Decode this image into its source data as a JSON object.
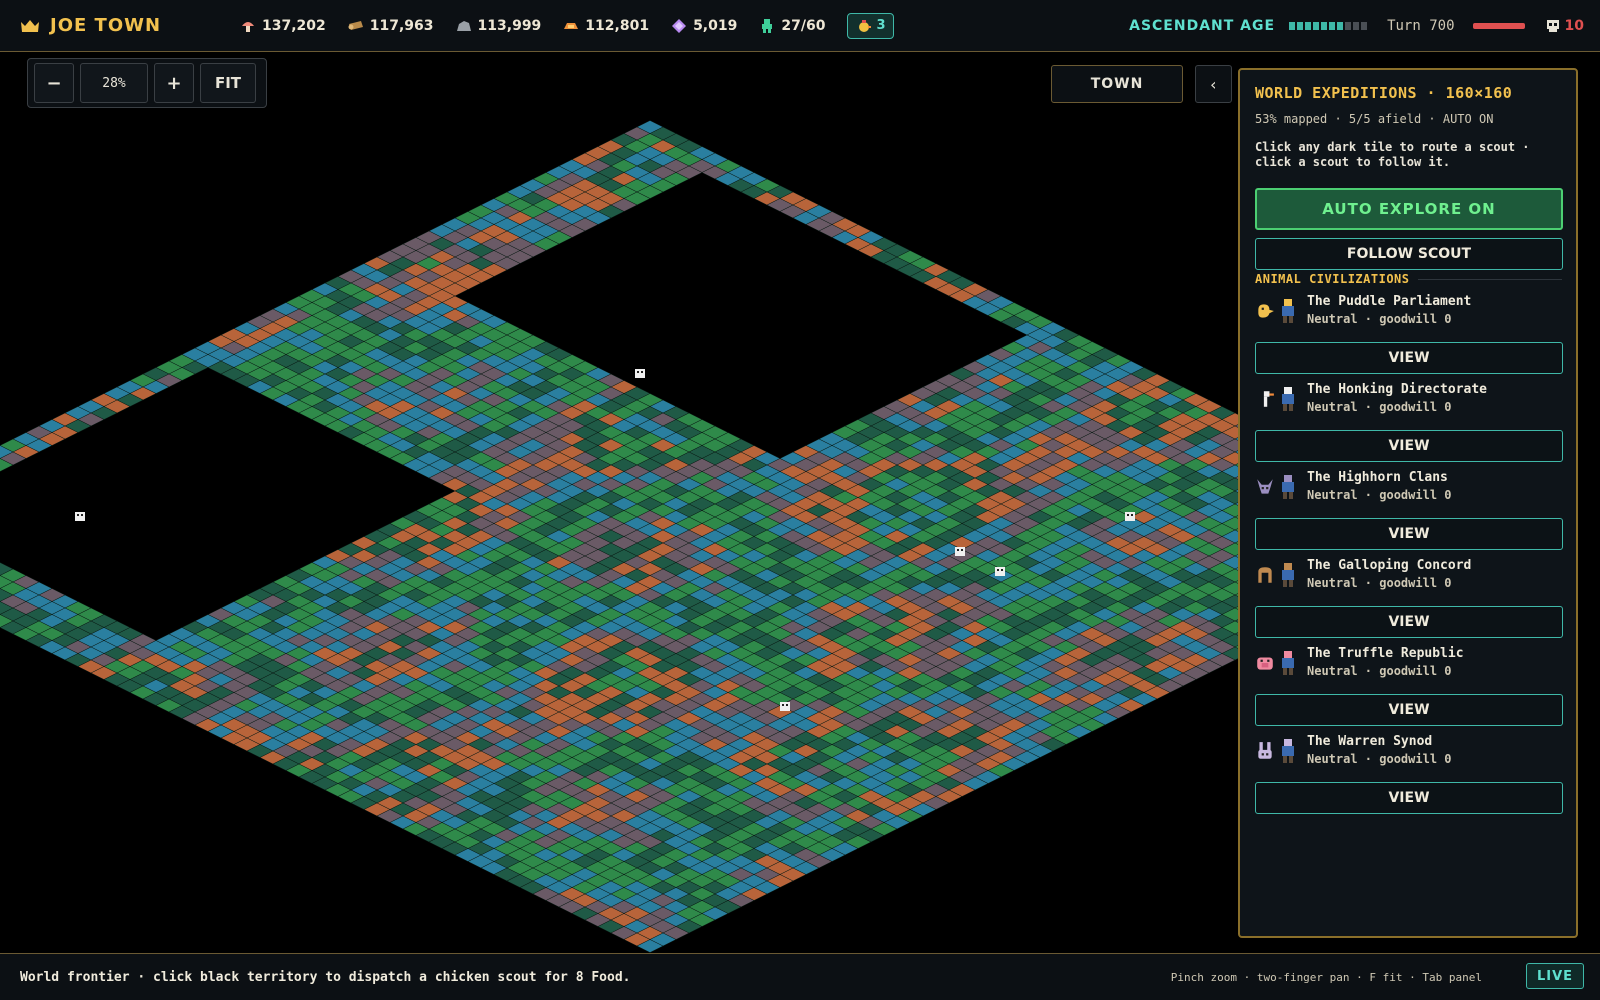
{
  "header": {
    "title": "JOE TOWN",
    "resources": [
      {
        "icon": "food-mushroom-icon",
        "value": "137,202",
        "color": "#f08a7a"
      },
      {
        "icon": "wood-log-icon",
        "value": "117,963",
        "color": "#b88a4a"
      },
      {
        "icon": "stone-icon",
        "value": "113,999",
        "color": "#9aa0a6"
      },
      {
        "icon": "ore-icon",
        "value": "112,801",
        "color": "#f0913a"
      },
      {
        "icon": "gem-icon",
        "value": "5,019",
        "color": "#b88af0"
      },
      {
        "icon": "population-icon",
        "value": "27/60",
        "color": "#3fcf9a"
      }
    ],
    "chicken_count": "3",
    "age_label": "ASCENDANT AGE",
    "age_progress": {
      "filled": 7,
      "total": 10
    },
    "turn": "Turn 700",
    "health_fraction": 1.0,
    "threat": "10"
  },
  "zoom": {
    "minus": "−",
    "value": "28%",
    "plus": "+",
    "fit": "FIT"
  },
  "town_button": "TOWN",
  "collapse_button": "‹",
  "panel": {
    "title": "WORLD EXPEDITIONS · 160×160",
    "stats": "53% mapped  ·  5/5 afield  ·  AUTO ON",
    "hint": "Click any dark tile to route a scout · click a scout to follow it.",
    "auto_button": "AUTO EXPLORE ON",
    "follow_button": "FOLLOW SCOUT",
    "section_title": "ANIMAL CIVILIZATIONS",
    "view_label": "VIEW",
    "civs": [
      {
        "name": "The Puddle Parliament",
        "status": "Neutral · goodwill 0",
        "icon": "duck-icon",
        "color": "#f2c14e"
      },
      {
        "name": "The Honking Directorate",
        "status": "Neutral · goodwill 0",
        "icon": "goose-icon",
        "color": "#f0f0f0"
      },
      {
        "name": "The Highhorn Clans",
        "status": "Neutral · goodwill 0",
        "icon": "goat-icon",
        "color": "#9a8ec0"
      },
      {
        "name": "The Galloping Concord",
        "status": "Neutral · goodwill 0",
        "icon": "horse-icon",
        "color": "#c08a50"
      },
      {
        "name": "The Truffle Republic",
        "status": "Neutral · goodwill 0",
        "icon": "pig-icon",
        "color": "#f08aa0"
      },
      {
        "name": "The Warren Synod",
        "status": "Neutral · goodwill 0",
        "icon": "rabbit-icon",
        "color": "#c8b8e0"
      }
    ]
  },
  "footer": {
    "message": "World frontier · click black territory to dispatch a chicken scout for 8 Food.",
    "controls": "Pinch zoom · two-finger pan · F fit · Tab panel",
    "live": "LIVE"
  },
  "colors": {
    "accent_gold": "#f2c14e",
    "accent_teal": "#3fb8a8",
    "terrain": [
      "#1f5a46",
      "#2f8a4a",
      "#2a7fa0",
      "#6a5a66",
      "#b8643a"
    ]
  }
}
